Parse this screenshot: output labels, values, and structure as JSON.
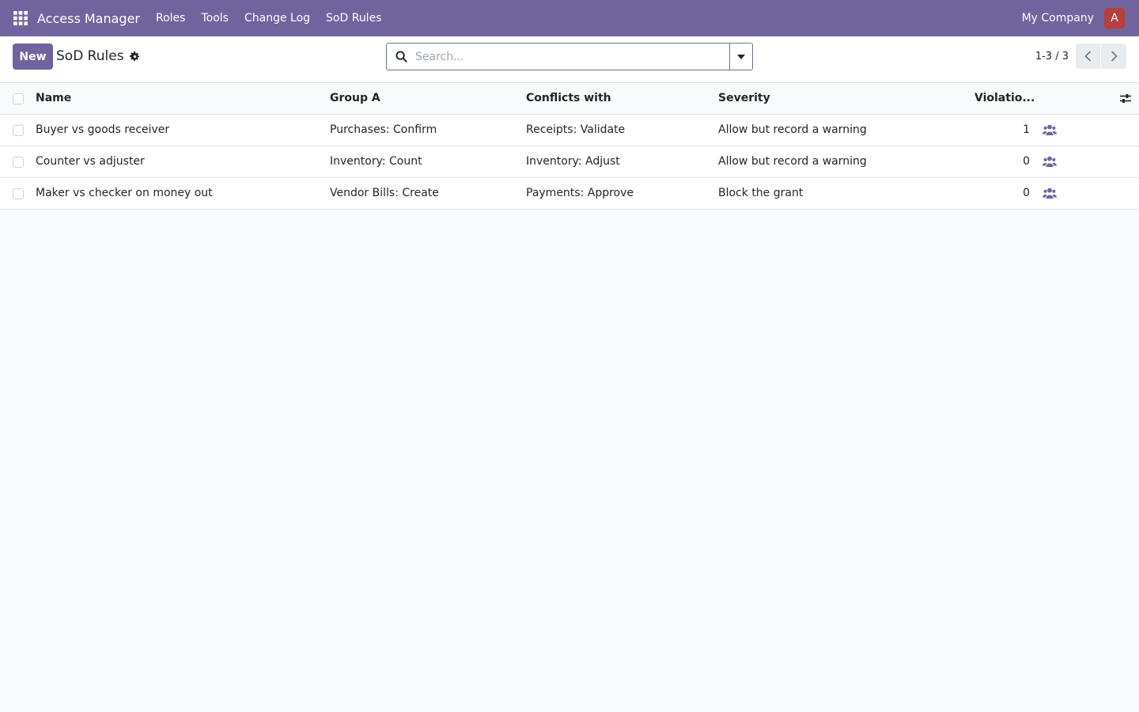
{
  "navbar": {
    "app_name": "Access Manager",
    "menu": [
      "Roles",
      "Tools",
      "Change Log",
      "SoD Rules"
    ],
    "company": "My Company",
    "avatar_letter": "A",
    "colors": {
      "brand": "#71639e",
      "avatar": "#b5403e"
    }
  },
  "control_panel": {
    "new_label": "New",
    "title": "SoD Rules",
    "search_placeholder": "Search...",
    "pager": "1-3 / 3"
  },
  "table": {
    "columns": {
      "name": "Name",
      "group_a": "Group A",
      "conflicts_with": "Conflicts with",
      "severity": "Severity",
      "violations": "Violatio..."
    },
    "rows": [
      {
        "name": "Buyer vs goods receiver",
        "group_a": "Purchases: Confirm",
        "conflicts_with": "Receipts: Validate",
        "severity": "Allow but record a warning",
        "violations": "1"
      },
      {
        "name": "Counter vs adjuster",
        "group_a": "Inventory: Count",
        "conflicts_with": "Inventory: Adjust",
        "severity": "Allow but record a warning",
        "violations": "0"
      },
      {
        "name": "Maker vs checker on money out",
        "group_a": "Vendor Bills: Create",
        "conflicts_with": "Payments: Approve",
        "severity": "Block the grant",
        "violations": "0"
      }
    ],
    "row_icon": "users-icon"
  }
}
